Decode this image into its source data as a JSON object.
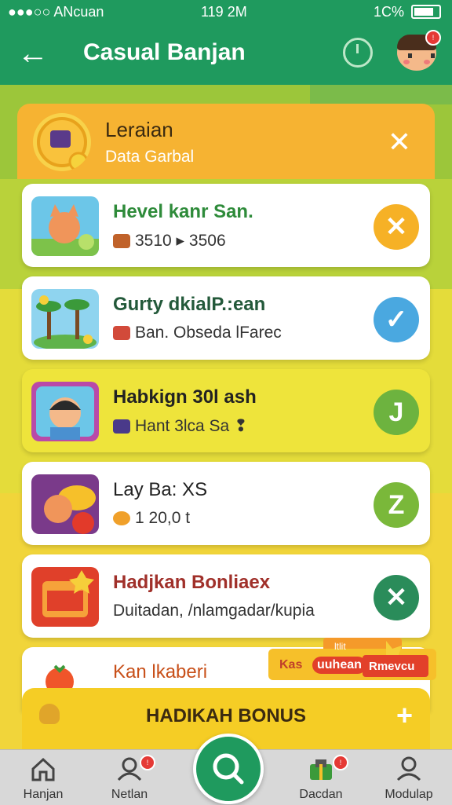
{
  "status_bar": {
    "carrier": "●●●○○ ANcuan",
    "time": "119 2M",
    "battery": "1C%"
  },
  "app_bar": {
    "title": "Casual Banjan",
    "profile_badge": "!"
  },
  "header": {
    "title": "Leraian",
    "subtitle": "Data Garbal"
  },
  "items": [
    {
      "name": "Hevel kanr San.",
      "sub": "3510 ▸ 3506",
      "action": "✕",
      "name_color": "#2e8b3a",
      "action_color": "#f6b126"
    },
    {
      "name": "Gurty dkialP.:ean",
      "sub": "Ban. Obseda lFarec",
      "action": "✓",
      "name_color": "#23593a",
      "action_color": "#4aa8e0"
    },
    {
      "name": "Habkign 30l ash",
      "sub": "Hant 3lca Sa ❢",
      "action": "J",
      "name_color": "#222222",
      "action_color": "#6db33f"
    },
    {
      "name": "Lay Ba: XS",
      "sub": "1 20,0 t",
      "action": "Z",
      "name_color": "#222222",
      "action_color": "#7ab83a"
    },
    {
      "name": "Hadjkan Bonliaex",
      "sub": "Duitadan, /nlamgadar/kupia",
      "action": "✕",
      "name_color": "#a0302a",
      "action_color": "#2a8c5a"
    },
    {
      "name": "Kan lkaberi",
      "sub": "",
      "action": "",
      "name_color": "#c8501a",
      "action_color": ""
    }
  ],
  "promo": {
    "left": "Kas",
    "middle": "uuhean",
    "right": "Rmevcu",
    "top": "ltlit"
  },
  "bonus": {
    "label": "HADIKAH BONUS",
    "plus": "+"
  },
  "nav": [
    {
      "label": "Hanjan",
      "icon": "home-icon",
      "badge": ""
    },
    {
      "label": "Netlan",
      "icon": "user-icon",
      "badge": "!"
    },
    {
      "label": "",
      "icon": "search-icon",
      "badge": ""
    },
    {
      "label": "Dacdan",
      "icon": "gift-icon",
      "badge": "!"
    },
    {
      "label": "Modulap",
      "icon": "person-icon",
      "badge": ""
    }
  ]
}
